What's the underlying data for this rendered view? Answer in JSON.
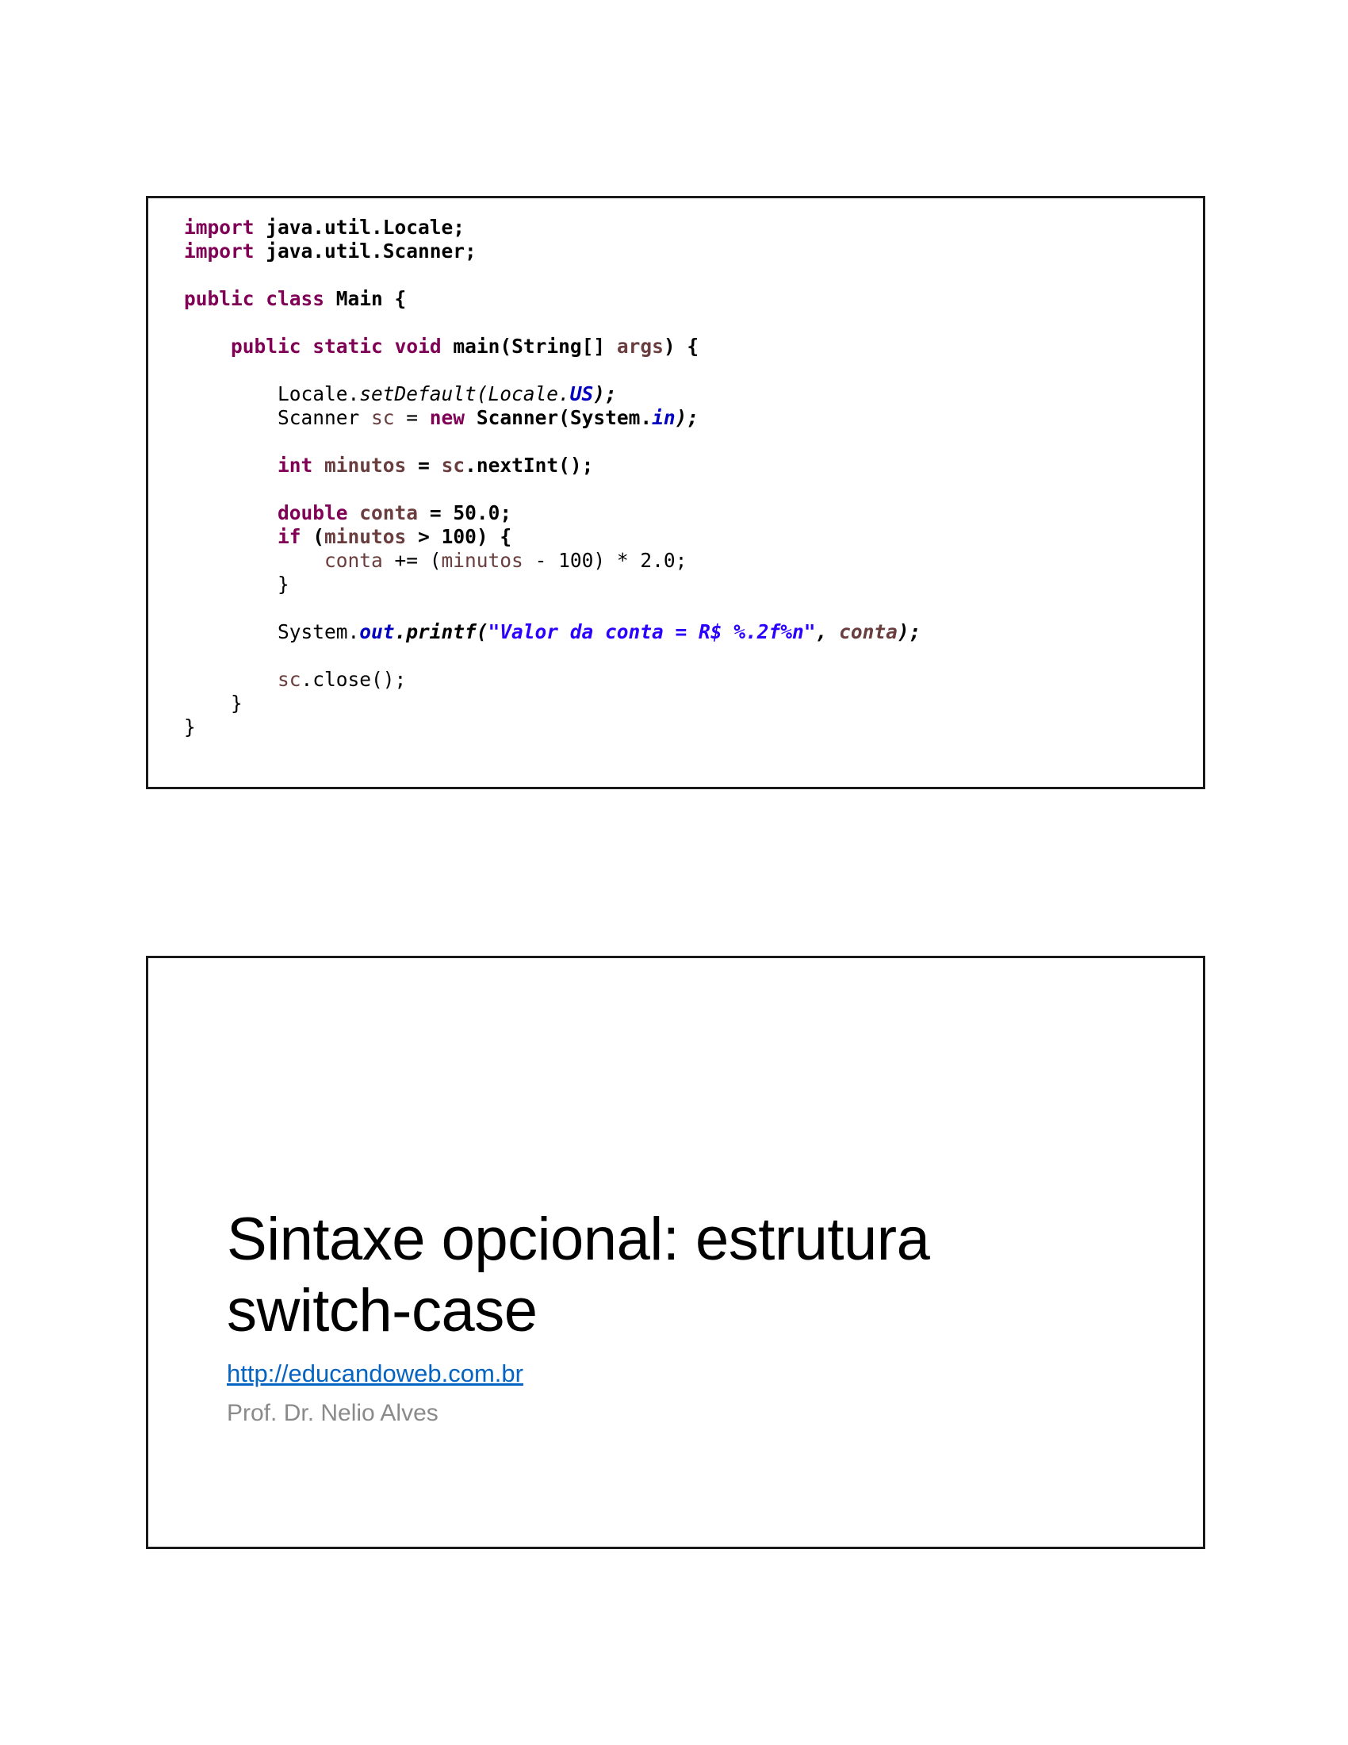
{
  "slide1": {
    "code_lines": [
      [
        {
          "t": "import",
          "c": "kw"
        },
        {
          "t": " java.util.Locale;",
          "c": "b"
        }
      ],
      [
        {
          "t": "import",
          "c": "kw"
        },
        {
          "t": " java.util.Scanner;",
          "c": "b"
        }
      ],
      [],
      [
        {
          "t": "public",
          "c": "kw"
        },
        {
          "t": " "
        },
        {
          "t": "class",
          "c": "kw"
        },
        {
          "t": " Main {",
          "c": "b"
        }
      ],
      [],
      [
        {
          "t": "    "
        },
        {
          "t": "public",
          "c": "kw"
        },
        {
          "t": " "
        },
        {
          "t": "static",
          "c": "kw"
        },
        {
          "t": " "
        },
        {
          "t": "void",
          "c": "kw"
        },
        {
          "t": " main(String[] ",
          "c": "b"
        },
        {
          "t": "args",
          "c": "var b"
        },
        {
          "t": ") {",
          "c": "b"
        }
      ],
      [],
      [
        {
          "t": "        Locale."
        },
        {
          "t": "setDefault(Locale.",
          "c": "i"
        },
        {
          "t": "US",
          "c": "field b i"
        },
        {
          "t": ");",
          "c": "b i"
        }
      ],
      [
        {
          "t": "        Scanner "
        },
        {
          "t": "sc",
          "c": "var"
        },
        {
          "t": " = "
        },
        {
          "t": "new",
          "c": "kw"
        },
        {
          "t": " Scanner(System.",
          "c": "b"
        },
        {
          "t": "in",
          "c": "field b i"
        },
        {
          "t": ");",
          "c": "b i"
        }
      ],
      [],
      [
        {
          "t": "        "
        },
        {
          "t": "int",
          "c": "kw"
        },
        {
          "t": " "
        },
        {
          "t": "minutos",
          "c": "var b"
        },
        {
          "t": " = ",
          "c": "b"
        },
        {
          "t": "sc",
          "c": "var b"
        },
        {
          "t": ".nextInt();",
          "c": "b"
        }
      ],
      [],
      [
        {
          "t": "        "
        },
        {
          "t": "double",
          "c": "kw"
        },
        {
          "t": " "
        },
        {
          "t": "conta",
          "c": "var b"
        },
        {
          "t": " = 50.0;",
          "c": "b"
        }
      ],
      [
        {
          "t": "        "
        },
        {
          "t": "if",
          "c": "kw"
        },
        {
          "t": " (",
          "c": "b"
        },
        {
          "t": "minutos",
          "c": "var b"
        },
        {
          "t": " > 100) {",
          "c": "b"
        }
      ],
      [
        {
          "t": "            "
        },
        {
          "t": "conta",
          "c": "var"
        },
        {
          "t": " += ("
        },
        {
          "t": "minutos",
          "c": "var"
        },
        {
          "t": " - 100) * 2.0;"
        }
      ],
      [
        {
          "t": "        }"
        }
      ],
      [],
      [
        {
          "t": "        System."
        },
        {
          "t": "out",
          "c": "field b i"
        },
        {
          "t": ".printf(",
          "c": "b i"
        },
        {
          "t": "\"Valor da conta = R$ %.2f%n\"",
          "c": "str b i"
        },
        {
          "t": ", ",
          "c": "b i"
        },
        {
          "t": "conta",
          "c": "var b i"
        },
        {
          "t": ");",
          "c": "b i"
        }
      ],
      [],
      [
        {
          "t": "        "
        },
        {
          "t": "sc",
          "c": "var"
        },
        {
          "t": ".close();"
        }
      ],
      [
        {
          "t": "    }"
        }
      ],
      [
        {
          "t": "}"
        }
      ]
    ]
  },
  "slide2": {
    "title_line1": "Sintaxe opcional: estrutura",
    "title_line2": "switch-case",
    "link": "http://educandoweb.com.br",
    "author": "Prof. Dr. Nelio Alves"
  },
  "colors": {
    "keyword": "#7f0055",
    "variable": "#6a3e3e",
    "field": "#0000c0",
    "string": "#2a00ff",
    "link": "#0563c1",
    "author": "#8a8a8a"
  }
}
